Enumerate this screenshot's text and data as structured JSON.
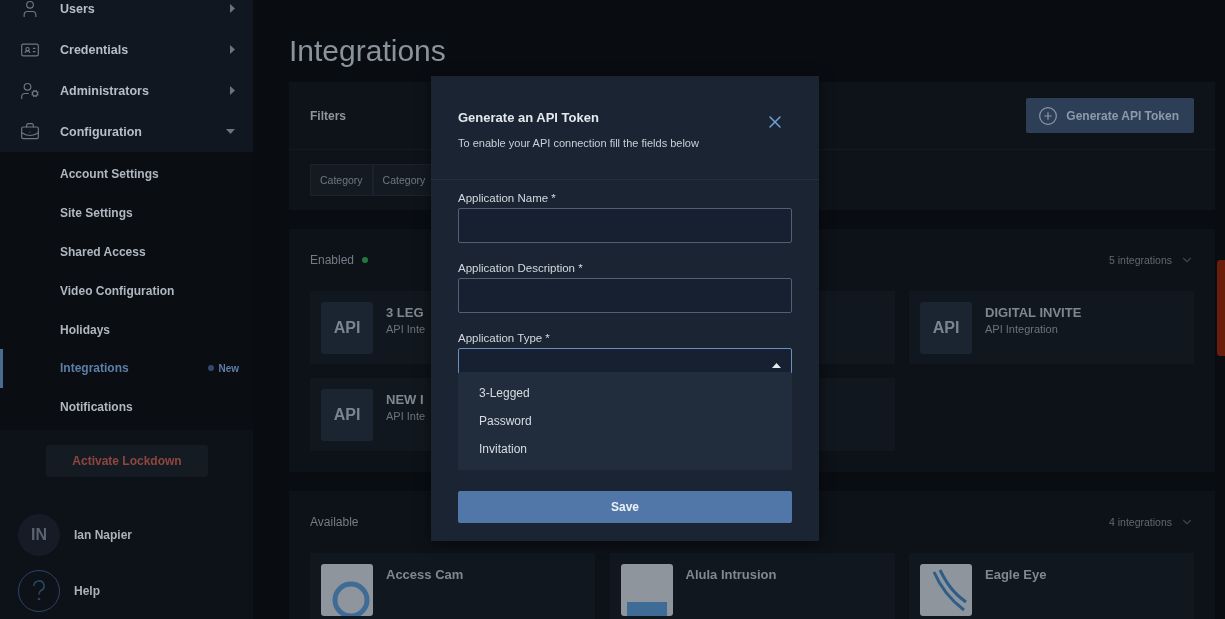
{
  "sidebar": {
    "nav_items": [
      {
        "label": "Users",
        "expanded": false
      },
      {
        "label": "Credentials",
        "expanded": false
      },
      {
        "label": "Administrators",
        "expanded": false
      },
      {
        "label": "Configuration",
        "expanded": true,
        "children": [
          {
            "label": "Account Settings",
            "selected": false
          },
          {
            "label": "Site Settings",
            "selected": false
          },
          {
            "label": "Shared Access",
            "selected": false
          },
          {
            "label": "Video Configuration",
            "selected": false
          },
          {
            "label": "Holidays",
            "selected": false
          },
          {
            "label": "Integrations",
            "selected": true,
            "badge": "New"
          },
          {
            "label": "Notifications",
            "selected": false
          }
        ]
      }
    ],
    "lockdown_button": "Activate Lockdown",
    "user": {
      "initials": "IN",
      "name": "Ian Napier"
    },
    "help": "Help"
  },
  "page_title": "Integrations",
  "filters": {
    "title": "Filters",
    "button": "Generate API Token",
    "category_filters": [
      "Category",
      "Category"
    ]
  },
  "sections": [
    {
      "title": "Enabled",
      "status_dot": true,
      "count": "5 integrations",
      "cards": [
        {
          "kind": "api",
          "logo_text": "API",
          "title": "3 LEG",
          "subtitle": "API Inte"
        },
        {
          "kind": "covered"
        },
        {
          "kind": "api",
          "logo_text": "API",
          "title": "DIGITAL INVITE",
          "subtitle": "API Integration"
        },
        {
          "kind": "api",
          "logo_text": "API",
          "title": "NEW I",
          "subtitle": "API Inte"
        },
        {
          "kind": "covered"
        }
      ]
    },
    {
      "title": "Available",
      "status_dot": false,
      "count": "4 integrations",
      "cards": [
        {
          "kind": "image",
          "title": "Access Cam"
        },
        {
          "kind": "image",
          "title": "Alula Intrusion"
        },
        {
          "kind": "image",
          "title": "Eagle Eye"
        }
      ]
    }
  ],
  "modal": {
    "title": "Generate an API Token",
    "subtitle": "To enable your API connection fill the fields below",
    "fields": [
      {
        "label": "Application Name *",
        "kind": "text"
      },
      {
        "label": "Application Description *",
        "kind": "text"
      },
      {
        "label": "Application Type *",
        "kind": "select",
        "expanded": true,
        "options": [
          "3-Legged",
          "Password",
          "Invitation"
        ]
      }
    ],
    "save_button": "Save"
  }
}
